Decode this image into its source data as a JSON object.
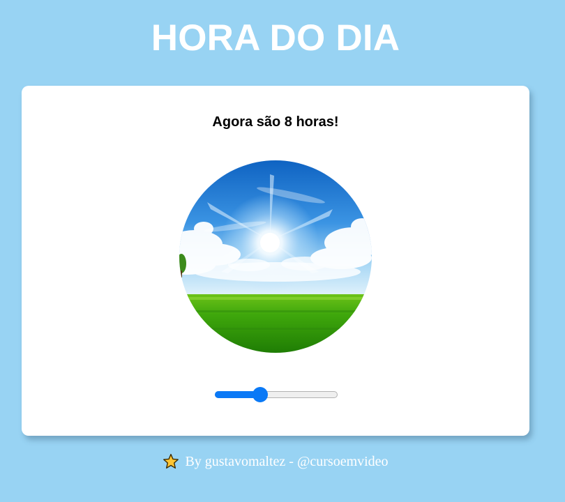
{
  "page": {
    "title": "HORA DO DIA",
    "background_color": "#98d3f3"
  },
  "card": {
    "message": "Agora são 8 horas!",
    "scene": {
      "image": "morning-sky-field",
      "description_icon": "sun-sky-grass-image"
    },
    "slider": {
      "min": 0,
      "max": 23,
      "value": 8,
      "accent_color": "#0a79f6"
    }
  },
  "footer": {
    "icon": "star-icon",
    "text": "By gustavomaltez - @cursoemvideo"
  }
}
